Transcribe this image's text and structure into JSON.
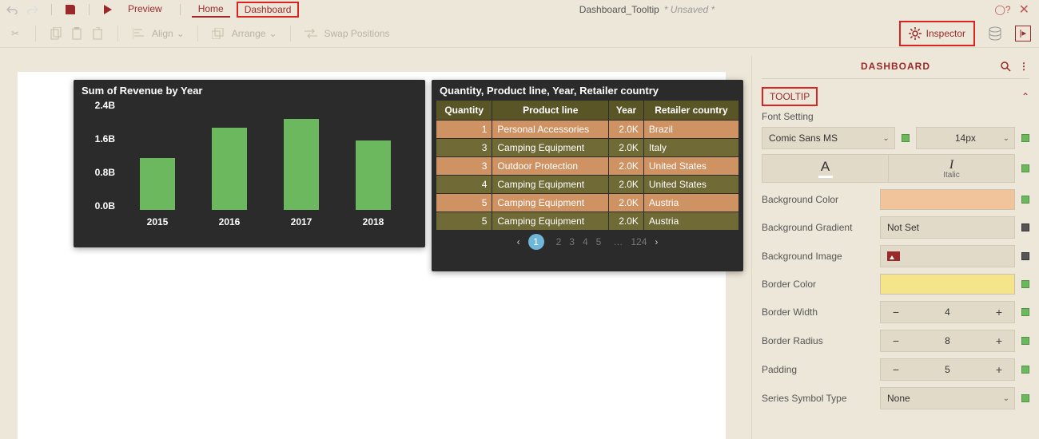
{
  "topbar": {
    "preview": "Preview",
    "home": "Home",
    "dashboard": "Dashboard",
    "title": "Dashboard_Tooltip",
    "unsaved": "* Unsaved *"
  },
  "ribbon": {
    "align": "Align",
    "arrange": "Arrange",
    "swap": "Swap Positions",
    "inspector": "Inspector"
  },
  "panel": {
    "title": "DASHBOARD",
    "section": "TOOLTIP",
    "fontSetting": "Font Setting",
    "fontFamily": "Comic Sans MS",
    "fontSize": "14px",
    "italic": "Italic",
    "backgroundColor": "Background Color",
    "backgroundGradient": "Background Gradient",
    "backgroundGradientValue": "Not Set",
    "backgroundImage": "Background Image",
    "borderColor": "Border Color",
    "borderWidth": "Border Width",
    "borderWidthValue": "4",
    "borderRadius": "Border Radius",
    "borderRadiusValue": "8",
    "padding": "Padding",
    "paddingValue": "5",
    "seriesSymbolType": "Series Symbol Type",
    "seriesSymbolValue": "None",
    "colors": {
      "bg": "#f1c49b",
      "border": "#f5e58a"
    }
  },
  "chart_data": {
    "type": "bar",
    "title": "Sum of Revenue by Year",
    "categories": [
      "2015",
      "2016",
      "2017",
      "2018"
    ],
    "values": [
      1.2,
      1.9,
      2.1,
      1.6
    ],
    "yticks": [
      "2.4B",
      "1.6B",
      "0.8B",
      "0.0B"
    ],
    "ylim": [
      0,
      2.4
    ],
    "ylabel": "",
    "xlabel": ""
  },
  "table": {
    "title": "Quantity, Product line, Year, Retailer country",
    "columns": [
      "Quantity",
      "Product line",
      "Year",
      "Retailer country"
    ],
    "rows": [
      {
        "q": "1",
        "p": "Personal Accessories",
        "y": "2.0K",
        "c": "Brazil"
      },
      {
        "q": "3",
        "p": "Camping Equipment",
        "y": "2.0K",
        "c": "Italy"
      },
      {
        "q": "3",
        "p": "Outdoor Protection",
        "y": "2.0K",
        "c": "United States"
      },
      {
        "q": "4",
        "p": "Camping Equipment",
        "y": "2.0K",
        "c": "United States"
      },
      {
        "q": "5",
        "p": "Camping Equipment",
        "y": "2.0K",
        "c": "Austria"
      },
      {
        "q": "5",
        "p": "Camping Equipment",
        "y": "2.0K",
        "c": "Austria"
      }
    ],
    "pager": {
      "current": "1",
      "pages": [
        "2",
        "3",
        "4",
        "5"
      ],
      "last": "124"
    }
  }
}
